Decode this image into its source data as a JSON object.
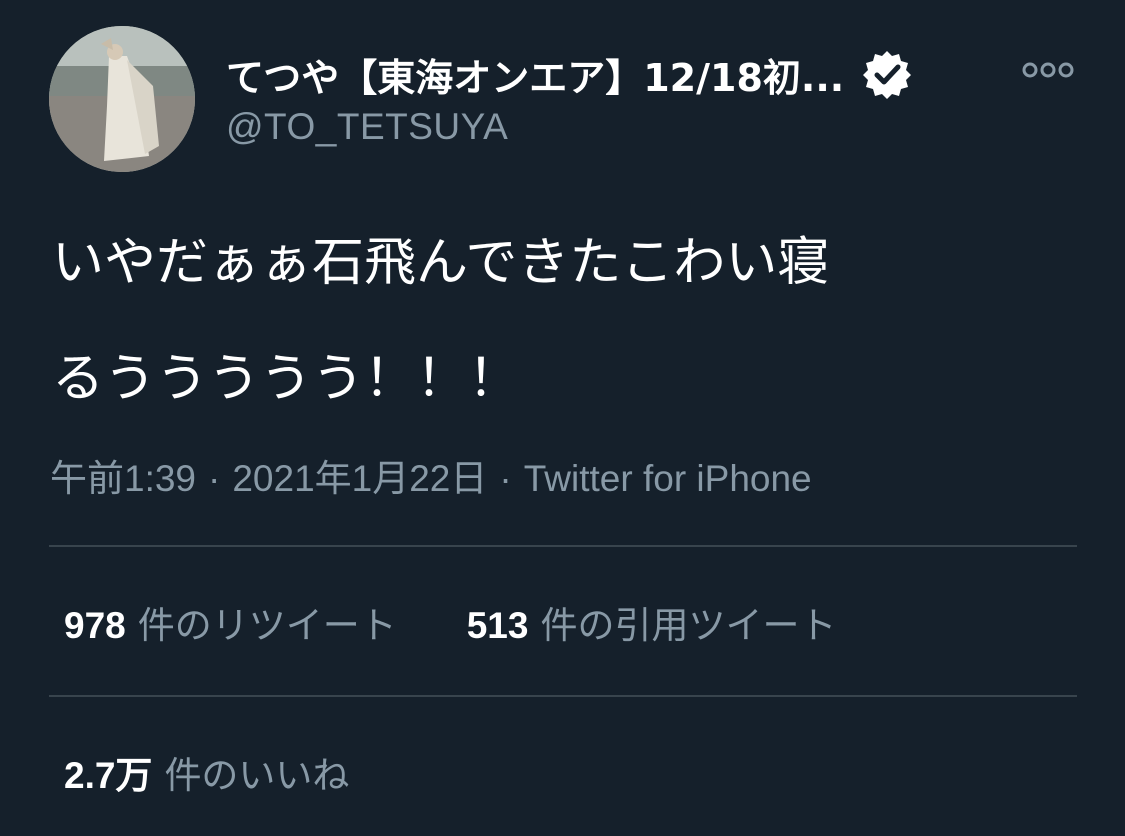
{
  "colors": {
    "background": "#15202b",
    "text_primary": "#ffffff",
    "text_secondary": "#8899a6",
    "divider": "#38444d",
    "verified_badge": "#ffffff"
  },
  "user": {
    "display_name": "てつや【東海オンエア】12/18初...",
    "handle": "@TO_TETSUYA",
    "verified_icon": "verified-badge-icon",
    "more_icon": "more-options-icon"
  },
  "tweet": {
    "text_line1": "いやだぁぁ石飛んできたこわい寝",
    "text_line2": "るううううう！！！"
  },
  "meta": {
    "time": "午前1:39",
    "separator": "·",
    "date": "2021年1月22日",
    "source": "Twitter for iPhone"
  },
  "stats": {
    "retweets_count": "978",
    "retweets_label": "件のリツイート",
    "quotes_count": "513",
    "quotes_label": "件の引用ツイート",
    "likes_count": "2.7万",
    "likes_label": "件のいいね"
  }
}
